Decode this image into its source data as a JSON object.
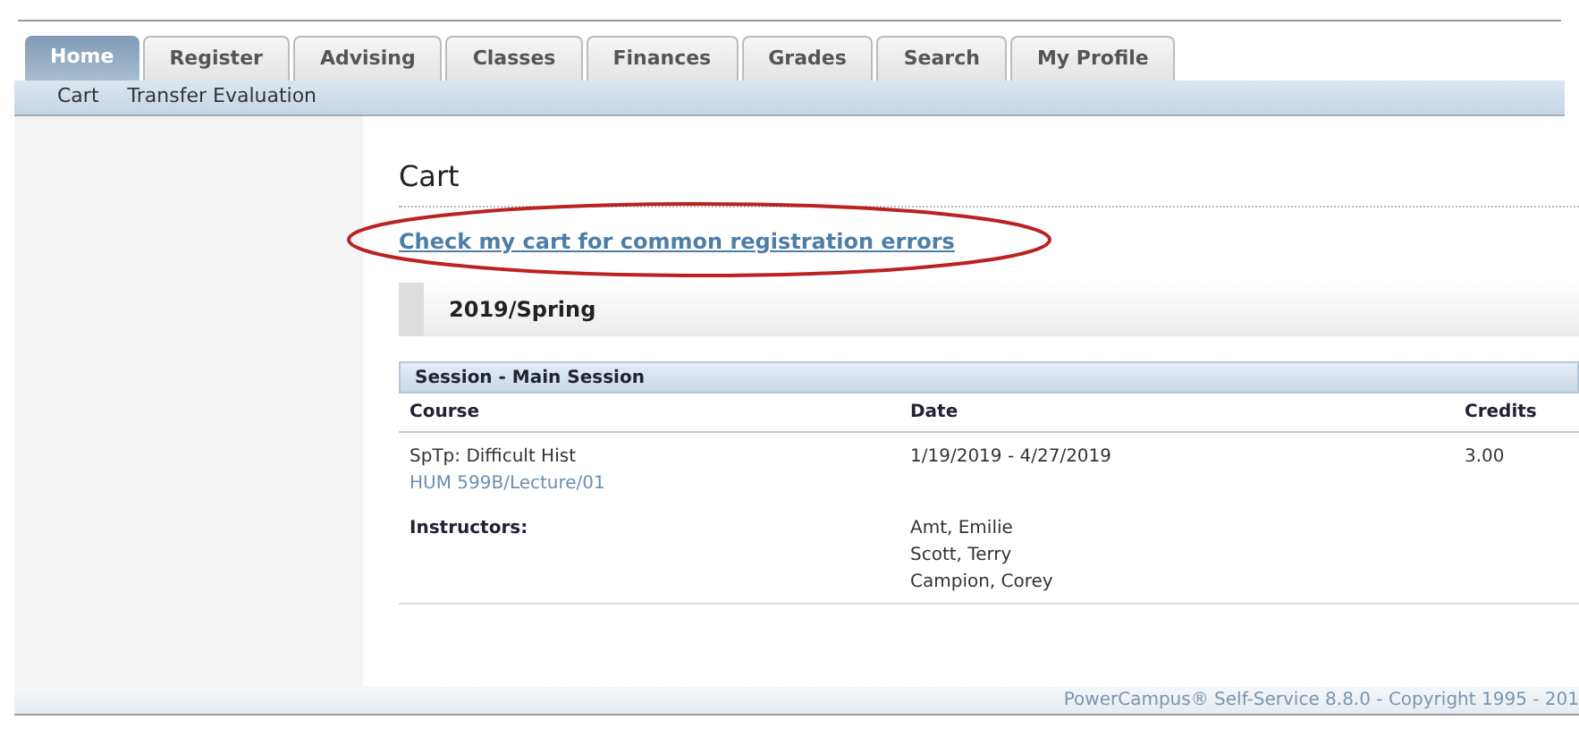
{
  "tabs": [
    {
      "label": "Home",
      "selected": true
    },
    {
      "label": "Register",
      "selected": false
    },
    {
      "label": "Advising",
      "selected": false
    },
    {
      "label": "Classes",
      "selected": false
    },
    {
      "label": "Finances",
      "selected": false
    },
    {
      "label": "Grades",
      "selected": false
    },
    {
      "label": "Search",
      "selected": false
    },
    {
      "label": "My Profile",
      "selected": false
    }
  ],
  "subnav": [
    "Cart",
    "Transfer Evaluation"
  ],
  "page_title": "Cart",
  "check_link": "Check my cart for common registration errors",
  "term": "2019/Spring",
  "session": {
    "title": "Session - Main Session",
    "columns": [
      "Course",
      "Date",
      "Credits"
    ],
    "course": {
      "name": "SpTp: Difficult Hist",
      "section": "HUM 599B/Lecture/01",
      "date": "1/19/2019 - 4/27/2019",
      "credits": "3.00"
    },
    "instructors_label": "Instructors:",
    "instructors": [
      "Amt, Emilie",
      "Scott, Terry",
      "Campion, Corey"
    ]
  },
  "footer": "PowerCampus® Self-Service 8.8.0 - Copyright 1995 - 201"
}
